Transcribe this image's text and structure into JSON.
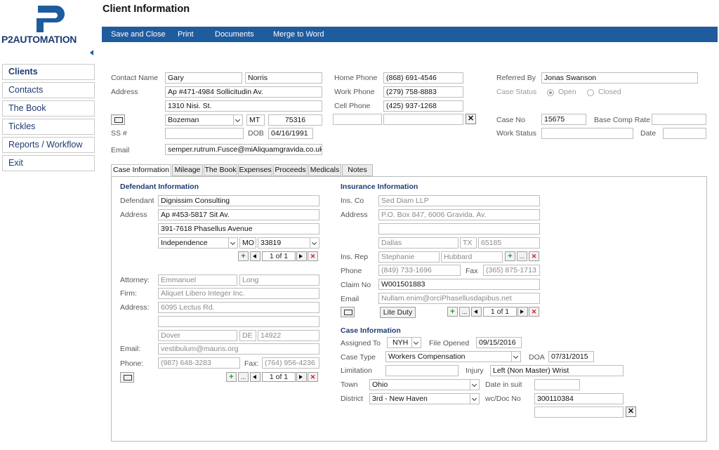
{
  "app": {
    "logo_text": "P2AUTOMATION",
    "title": "Client Information"
  },
  "toolbar": {
    "save_close": "Save and Close",
    "print": "Print",
    "documents": "Documents",
    "merge": "Merge to Word"
  },
  "sidebar": {
    "items": [
      "Clients",
      "Contacts",
      "The Book",
      "Tickles",
      "Reports / Workflow",
      "Exit"
    ]
  },
  "contact": {
    "contact_name_label": "Contact Name",
    "first_name": "Gary",
    "last_name": "Norris",
    "address_label": "Address",
    "address1": "Ap #471-4984 Sollicitudin Av.",
    "address2": "1310 Nisi. St.",
    "city": "Bozeman",
    "state": "MT",
    "zip": "75316",
    "ssn_label": "SS #",
    "ssn": "",
    "dob_label": "DOB",
    "dob": "04/16/1991",
    "email_label": "Email",
    "email": "semper.rutrum.Fusce@miAliquamgravida.co.uk",
    "home_phone_label": "Home Phone",
    "home_phone": "(868) 691-4546",
    "work_phone_label": "Work Phone",
    "work_phone": "(279) 758-8883",
    "cell_phone_label": "Cell Phone",
    "cell_phone": "(425) 937-1268",
    "referred_by_label": "Referred By",
    "referred_by": "Jonas Swanson",
    "case_status_label": "Case Status",
    "status_open": "Open",
    "status_closed": "Closed",
    "case_no_label": "Case No",
    "case_no": "15675",
    "base_comp_label": "Base Comp Rate",
    "work_status_label": "Work Status",
    "date_label": "Date"
  },
  "tabs": [
    "Case Information",
    "Mileage",
    "The Book",
    "Expenses",
    "Proceeds",
    "Medicals",
    "Notes"
  ],
  "defendant": {
    "section_title": "Defendant Information",
    "defendant_label": "Defendant",
    "defendant": "Dignissim Consulting",
    "address_label": "Address",
    "address1": "Ap #453-5817 Sit Av.",
    "address2": "391-7618 Phasellus Avenue",
    "city": "Independence",
    "state": "MO",
    "zip": "33819",
    "record_nav": "1 of 1",
    "attorney_label": "Attorney:",
    "attorney_first": "Emmanuel",
    "attorney_last": "Long",
    "firm_label": "Firm:",
    "firm": "Aliquet Libero Integer Inc.",
    "firm_address_label": "Address:",
    "firm_address": "6095 Lectus Rd.",
    "firm_city": "Dover",
    "firm_state": "DE",
    "firm_zip": "14922",
    "email_label": "Email:",
    "email": "vestibulum@mauris.org",
    "phone_label": "Phone:",
    "phone": "(987) 648-3283",
    "fax_label": "Fax:",
    "fax": "(764) 956-4236",
    "attorney_nav": "1 of 1"
  },
  "insurance": {
    "section_title": "Insurance Information",
    "ins_co_label": "Ins. Co",
    "ins_co": "Sed Diam LLP",
    "address_label": "Address",
    "address1": "P.O. Box 847, 6006 Gravida. Av.",
    "city": "Dallas",
    "state": "TX",
    "zip": "65185",
    "ins_rep_label": "Ins. Rep",
    "rep_first": "Stephanie",
    "rep_last": "Hubbard",
    "phone_label": "Phone",
    "phone": "(849) 733-1696",
    "fax_label": "Fax",
    "fax": "(365) 875-1713",
    "claim_no_label": "Claim No",
    "claim_no": "W001501883",
    "email_label": "Email",
    "email": "Nullam.enim@orciPhasellusdapibus.net",
    "lite_duty": "Lite Duty",
    "record_nav": "1 of 1"
  },
  "case": {
    "section_title": "Case Information",
    "assigned_to_label": "Assigned To",
    "assigned_to": "NYH",
    "file_opened_label": "File Opened",
    "file_opened": "09/15/2016",
    "case_type_label": "Case Type",
    "case_type": "Workers Compensation",
    "doa_label": "DOA",
    "doa": "07/31/2015",
    "limitation_label": "Limitation",
    "injury_label": "Injury",
    "injury": "Left (Non Master) Wrist",
    "town_label": "Town",
    "town": "Ohio",
    "date_in_suit_label": "Date in suit",
    "district_label": "District",
    "district": "3rd - New Haven",
    "wc_doc_label": "wc/Doc No",
    "wc_doc": "300110384"
  },
  "colors": {
    "toolbar_bg": "#1f5c9e",
    "accent_text": "#1f3b73",
    "add_green": "#1f9b2e",
    "delete_red": "#d21b1b"
  }
}
